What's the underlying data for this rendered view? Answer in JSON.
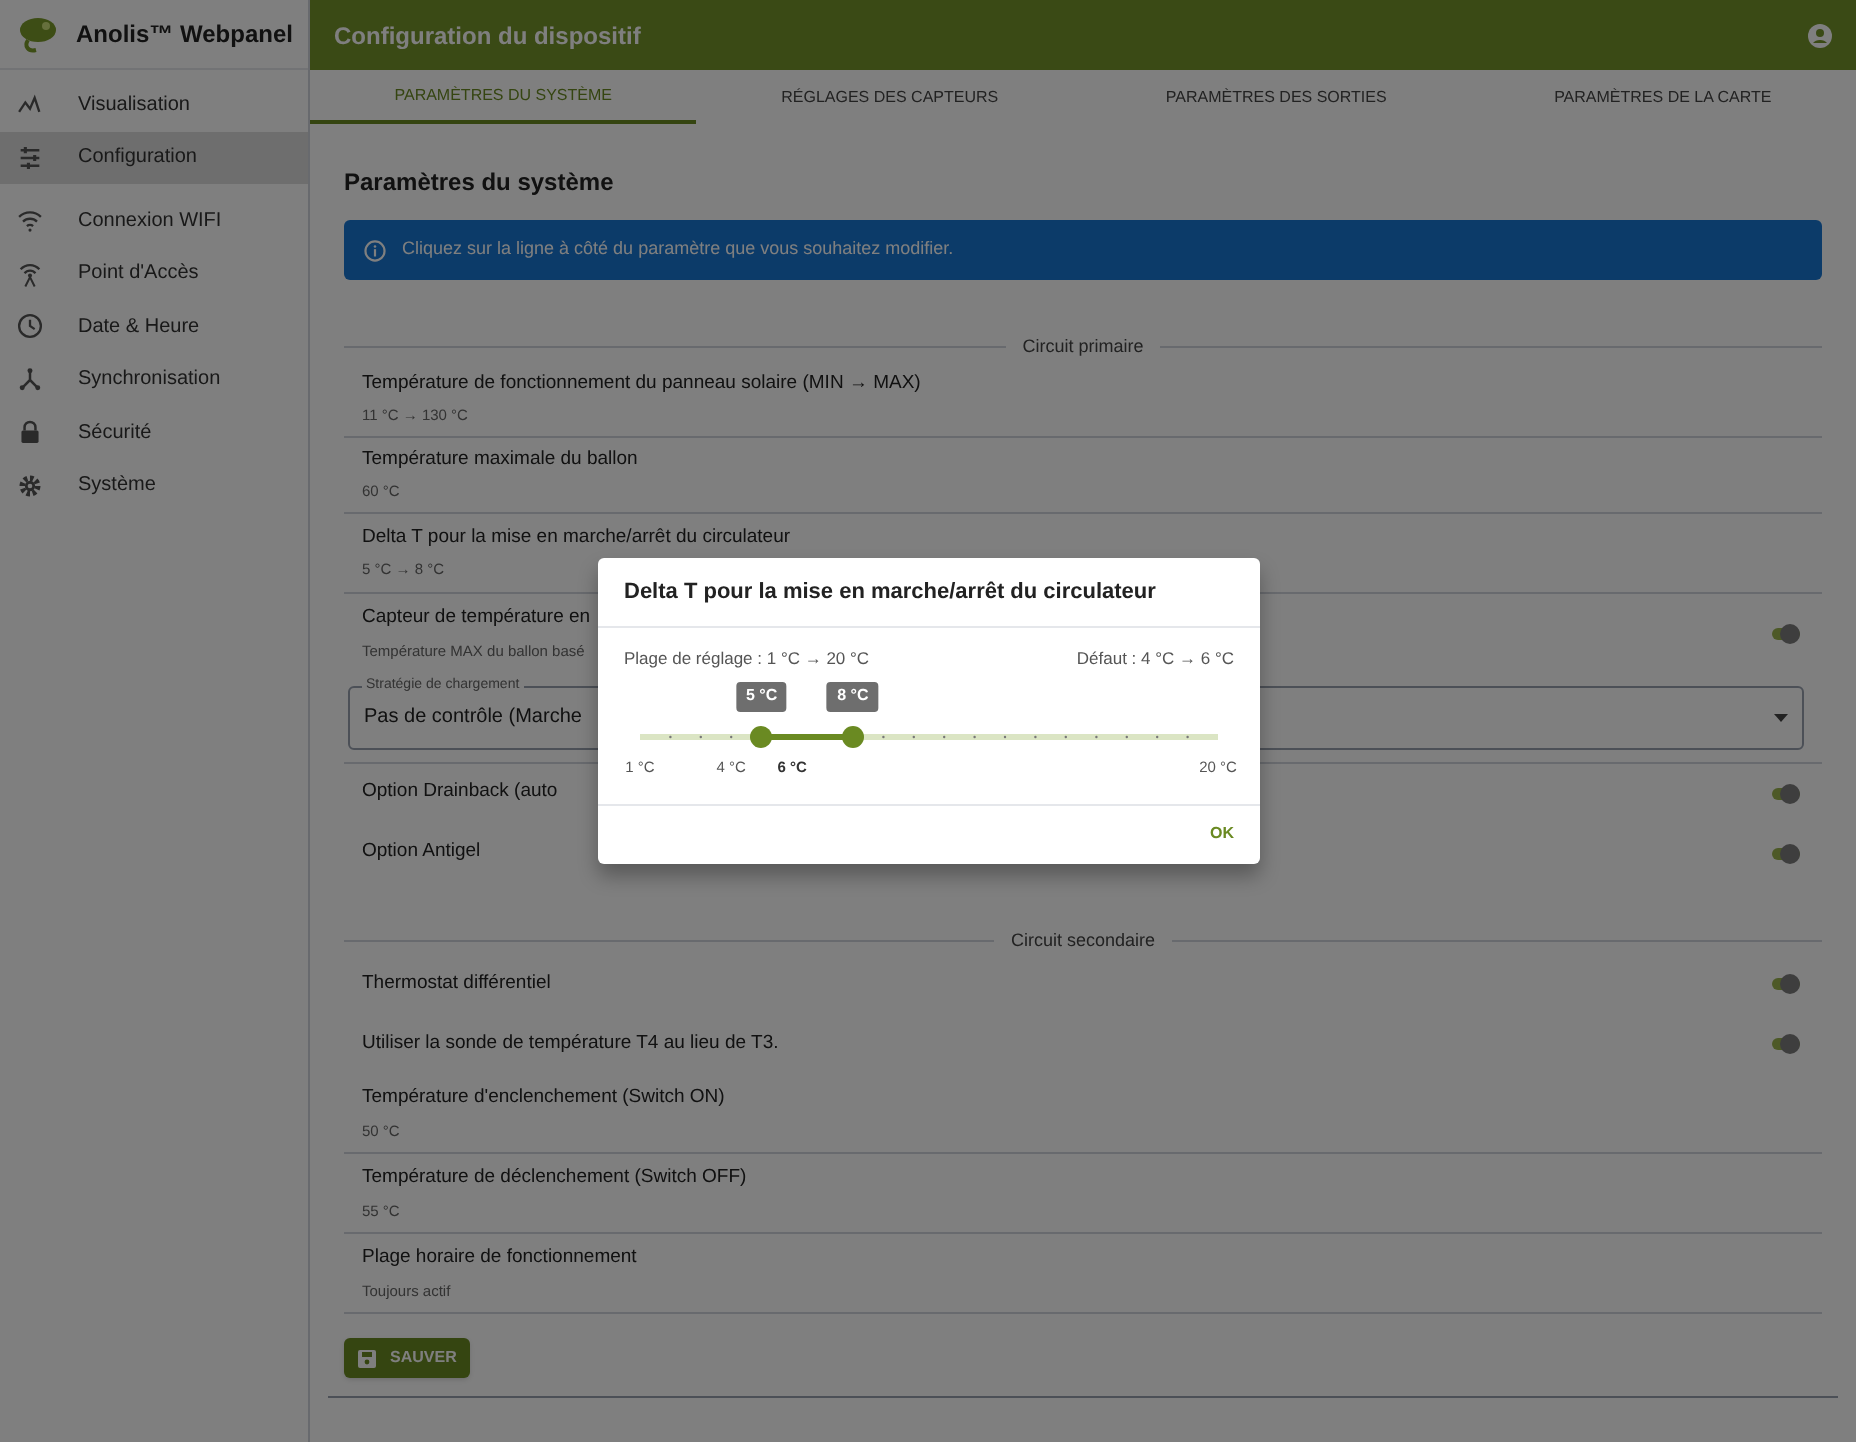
{
  "app": {
    "title": "Anolis™ Webpanel"
  },
  "sidebar": {
    "items": [
      {
        "label": "Visualisation",
        "selected": false
      },
      {
        "label": "Configuration",
        "selected": true
      },
      {
        "label": "Connexion WIFI",
        "selected": false
      },
      {
        "label": "Point d'Accès",
        "selected": false
      },
      {
        "label": "Date & Heure",
        "selected": false
      },
      {
        "label": "Synchronisation",
        "selected": false
      },
      {
        "label": "Sécurité",
        "selected": false
      },
      {
        "label": "Système",
        "selected": false
      }
    ]
  },
  "header": {
    "title": "Configuration du dispositif"
  },
  "tabs": [
    {
      "label": "PARAMÈTRES DU SYSTÈME",
      "selected": true
    },
    {
      "label": "RÉGLAGES DES CAPTEURS",
      "selected": false
    },
    {
      "label": "PARAMÈTRES DES SORTIES",
      "selected": false
    },
    {
      "label": "PARAMÈTRES DE LA CARTE",
      "selected": false
    }
  ],
  "page_title": "Paramètres du système",
  "info": "Cliquez sur la ligne à côté du paramètre que vous souhaitez modifier.",
  "sections": [
    {
      "title": "Circuit primaire",
      "rows": [
        {
          "kind": "value",
          "label": "Température de fonctionnement du panneau solaire (MIN → MAX)",
          "value": "11 °C → 130 °C"
        },
        {
          "kind": "value",
          "label": "Température maximale du ballon",
          "value": "60 °C"
        },
        {
          "kind": "value",
          "label": "Delta T pour la mise en marche/arrêt du circulateur",
          "value": "5 °C → 8 °C"
        },
        {
          "kind": "toggle",
          "label": "Capteur de température en",
          "value": "Température MAX du ballon basé",
          "on": true
        },
        {
          "kind": "select",
          "label": "Stratégie de chargement",
          "value": "Pas de contrôle (Marche"
        },
        {
          "kind": "toggle",
          "label": "Option Drainback (auto",
          "on": true
        },
        {
          "kind": "toggle",
          "label": "Option Antigel",
          "on": true
        }
      ]
    },
    {
      "title": "Circuit secondaire",
      "rows": [
        {
          "kind": "toggle",
          "label": "Thermostat différentiel",
          "on": true
        },
        {
          "kind": "toggle",
          "label": "Utiliser la sonde de température T4 au lieu de T3.",
          "on": true
        },
        {
          "kind": "value",
          "label": "Température d'enclenchement (Switch ON)",
          "value": "50 °C"
        },
        {
          "kind": "value",
          "label": "Température de déclenchement (Switch OFF)",
          "value": "55 °C"
        },
        {
          "kind": "value",
          "label": "Plage horaire de fonctionnement",
          "value": "Toujours actif"
        }
      ]
    }
  ],
  "save_button": "SAUVER",
  "dialog": {
    "title": "Delta T pour la mise en marche/arrêt du circulateur",
    "range": "Plage de réglage : 1 °C → 20 °C",
    "default": "Défaut : 4 °C → 6 °C",
    "slider": {
      "start": {
        "level": 0.2105,
        "label": "5 °C"
      },
      "end": {
        "level": 0.3684,
        "label": "8 °C"
      }
    },
    "scale": [
      {
        "label": "1 °C",
        "bold": false
      },
      {
        "label": "4 °C",
        "bold": false
      },
      {
        "label": "6 °C",
        "bold": true
      },
      {
        "label": "20 °C",
        "bold": false
      }
    ],
    "ok_button": "OK"
  }
}
